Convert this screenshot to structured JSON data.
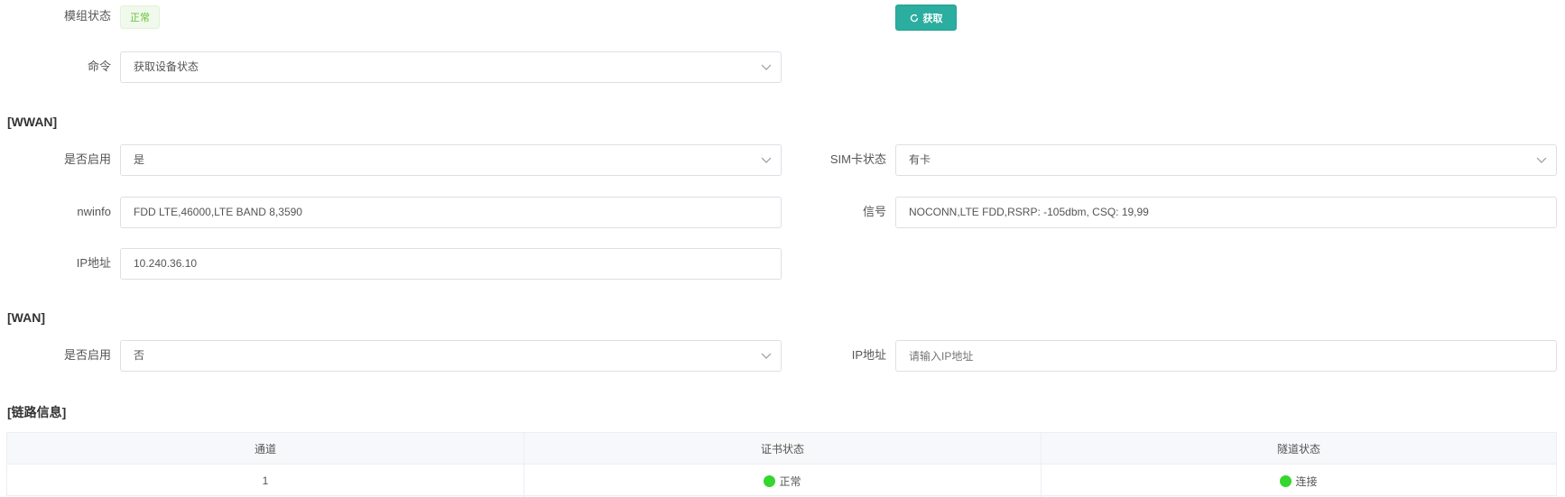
{
  "module": {
    "label": "模组状态",
    "status": "正常",
    "fetch_button": "获取"
  },
  "command": {
    "label": "命令",
    "value": "获取设备状态"
  },
  "wwan": {
    "title": "[WWAN]",
    "enabled_label": "是否启用",
    "enabled_value": "是",
    "sim_label": "SIM卡状态",
    "sim_value": "有卡",
    "nwinfo_label": "nwinfo",
    "nwinfo_value": "FDD LTE,46000,LTE BAND 8,3590",
    "signal_label": "信号",
    "signal_value": "NOCONN,LTE FDD,RSRP: -105dbm, CSQ: 19,99",
    "ip_label": "IP地址",
    "ip_value": "10.240.36.10"
  },
  "wan": {
    "title": "[WAN]",
    "enabled_label": "是否启用",
    "enabled_value": "否",
    "ip_label": "IP地址",
    "ip_placeholder": "请输入IP地址"
  },
  "link": {
    "title": "[链路信息]",
    "columns": [
      "通道",
      "证书状态",
      "隧道状态"
    ],
    "rows": [
      {
        "channel": "1",
        "cert_status": "正常",
        "tunnel_status": "连接"
      }
    ],
    "status_color": "#34d62f"
  },
  "colors": {
    "accent": "#2bada0",
    "tag_green": "#67c23a"
  }
}
